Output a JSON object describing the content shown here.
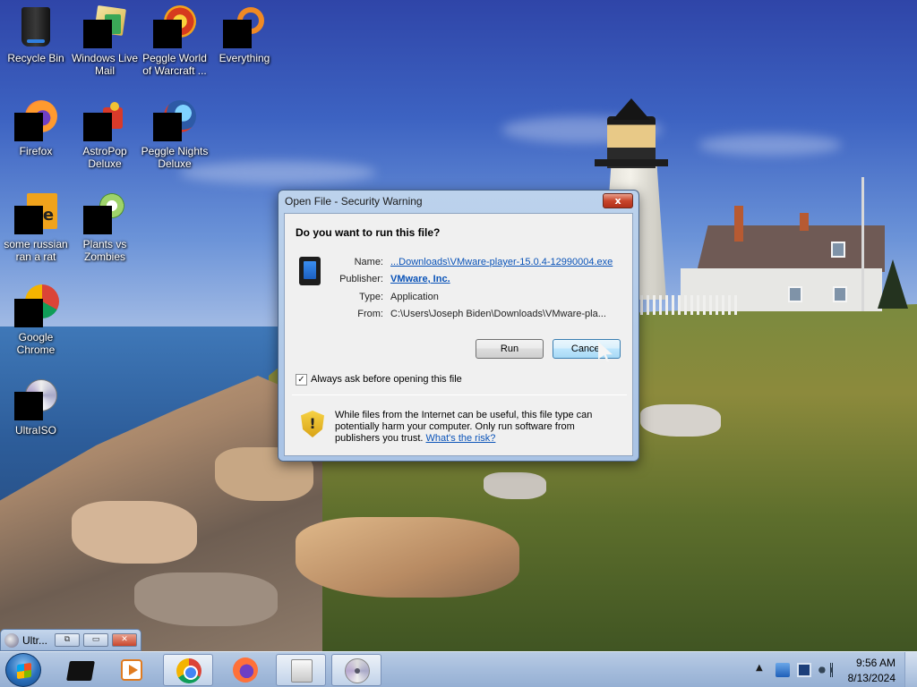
{
  "desktop": {
    "icons": [
      {
        "label": "Recycle Bin",
        "icon": "recycle-bin-icon"
      },
      {
        "label": "Windows Live Mail",
        "icon": "windows-live-mail-icon"
      },
      {
        "label": "Peggle World of Warcraft ...",
        "icon": "peggle-wow-icon"
      },
      {
        "label": "Everything",
        "icon": "everything-search-icon"
      },
      {
        "label": "Firefox",
        "icon": "firefox-icon"
      },
      {
        "label": "AstroPop Deluxe",
        "icon": "astropop-icon"
      },
      {
        "label": "Peggle Nights Deluxe",
        "icon": "peggle-nights-icon"
      },
      {
        "label": "some russian ran a rat",
        "icon": "rat-app-icon"
      },
      {
        "label": "Plants vs Zombies",
        "icon": "plants-vs-zombies-icon"
      },
      {
        "label": "Google Chrome",
        "icon": "chrome-icon"
      },
      {
        "label": "UltraISO",
        "icon": "ultraiso-icon"
      }
    ]
  },
  "dialog": {
    "title": "Open File - Security Warning",
    "close_label": "x",
    "question": "Do you want to run this file?",
    "fields": {
      "name_label": "Name:",
      "name_value": "...Downloads\\VMware-player-15.0.4-12990004.exe",
      "publisher_label": "Publisher:",
      "publisher_value": "VMware, Inc.",
      "type_label": "Type:",
      "type_value": "Application",
      "from_label": "From:",
      "from_value": "C:\\Users\\Joseph Biden\\Downloads\\VMware-pla..."
    },
    "run_label": "Run",
    "cancel_label": "Cancel",
    "checkbox": {
      "label": "Always ask before opening this file",
      "checked": true
    },
    "warning_text": "While files from the Internet can be useful, this file type can potentially harm your computer. Only run software from publishers you trust.",
    "risk_link": "What's the risk?"
  },
  "minimized_window": {
    "title": "Ultr...",
    "restore_label": "⧉",
    "maximize_label": "▭",
    "close_label": "✕"
  },
  "taskbar": {
    "items": [
      {
        "icon": "black-app-icon"
      },
      {
        "icon": "media-player-icon"
      },
      {
        "icon": "chrome-icon",
        "active": true
      },
      {
        "icon": "firefox-icon"
      },
      {
        "icon": "setup-installer-icon",
        "active": true
      },
      {
        "icon": "ultraiso-disc-icon",
        "active": true
      }
    ],
    "tray_chevron": "▲",
    "clock_time": "9:56 AM",
    "clock_date": "8/13/2024"
  }
}
